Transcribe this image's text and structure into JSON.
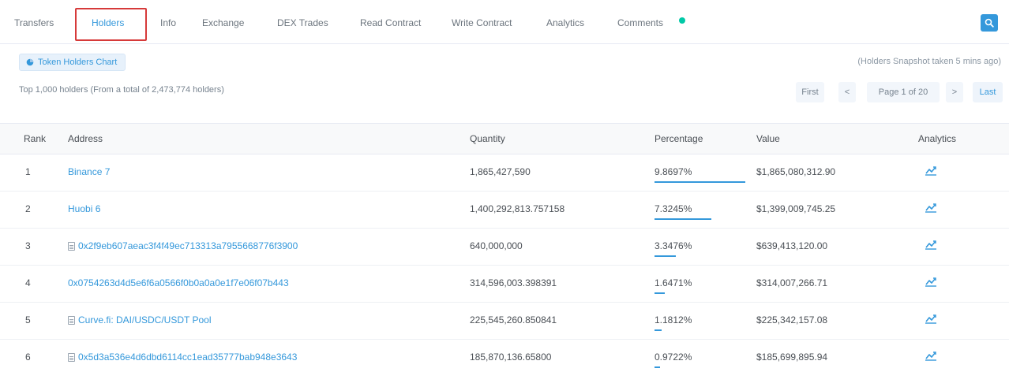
{
  "tabs": [
    {
      "label": "Transfers",
      "active": false
    },
    {
      "label": "Holders",
      "active": true
    },
    {
      "label": "Info",
      "active": false
    },
    {
      "label": "Exchange",
      "active": false
    },
    {
      "label": "DEX Trades",
      "active": false
    },
    {
      "label": "Read Contract",
      "active": false
    },
    {
      "label": "Write Contract",
      "active": false
    },
    {
      "label": "Analytics",
      "active": false
    },
    {
      "label": "Comments",
      "active": false
    }
  ],
  "toolbar": {
    "chart_button_label": "Token Holders Chart",
    "updated_text": "(Holders Snapshot taken 5 mins ago)",
    "summary_text": "Top 1,000 holders (From a total of 2,473,774 holders)"
  },
  "pagination": {
    "first": "First",
    "prev": "<",
    "page_info": "Page 1 of 20",
    "next": ">",
    "last": "Last"
  },
  "table": {
    "headers": [
      "Rank",
      "Address",
      "Quantity",
      "Percentage",
      "Value",
      "Analytics"
    ],
    "rows": [
      {
        "rank": "1",
        "address": "Binance 7",
        "contract": false,
        "quantity": "1,865,427,590",
        "percentage": "9.8697%",
        "pct_fraction": 0.99,
        "value": "$1,865,080,312.90"
      },
      {
        "rank": "2",
        "address": "Huobi 6",
        "contract": false,
        "quantity": "1,400,292,813.757158",
        "percentage": "7.3245%",
        "pct_fraction": 0.62,
        "value": "$1,399,009,745.25"
      },
      {
        "rank": "3",
        "address": "0x2f9eb607aeac3f4f49ec713313a7955668776f3900",
        "contract": true,
        "quantity": "640,000,000",
        "percentage": "3.3476%",
        "pct_fraction": 0.23,
        "value": "$639,413,120.00"
      },
      {
        "rank": "4",
        "address": "0x0754263d4d5e6f6a0566f0b0a0a0e1f7e06f07b443",
        "contract": false,
        "quantity": "314,596,003.398391",
        "percentage": "1.6471%",
        "pct_fraction": 0.11,
        "value": "$314,007,266.71"
      },
      {
        "rank": "5",
        "address": "Curve.fi: DAI/USDC/USDT Pool",
        "contract": true,
        "quantity": "225,545,260.850841",
        "percentage": "1.1812%",
        "pct_fraction": 0.08,
        "value": "$225,342,157.08"
      },
      {
        "rank": "6",
        "address": "0x5d3a536e4d6dbd6114cc1ead35777bab948e3643",
        "contract": true,
        "quantity": "185,870,136.65800",
        "percentage": "0.9722%",
        "pct_fraction": 0.06,
        "value": "$185,699,895.94"
      }
    ]
  },
  "colors": {
    "accent": "#3498db",
    "highlight_box": "#d63a3a",
    "status_dot": "#00c9a7"
  }
}
